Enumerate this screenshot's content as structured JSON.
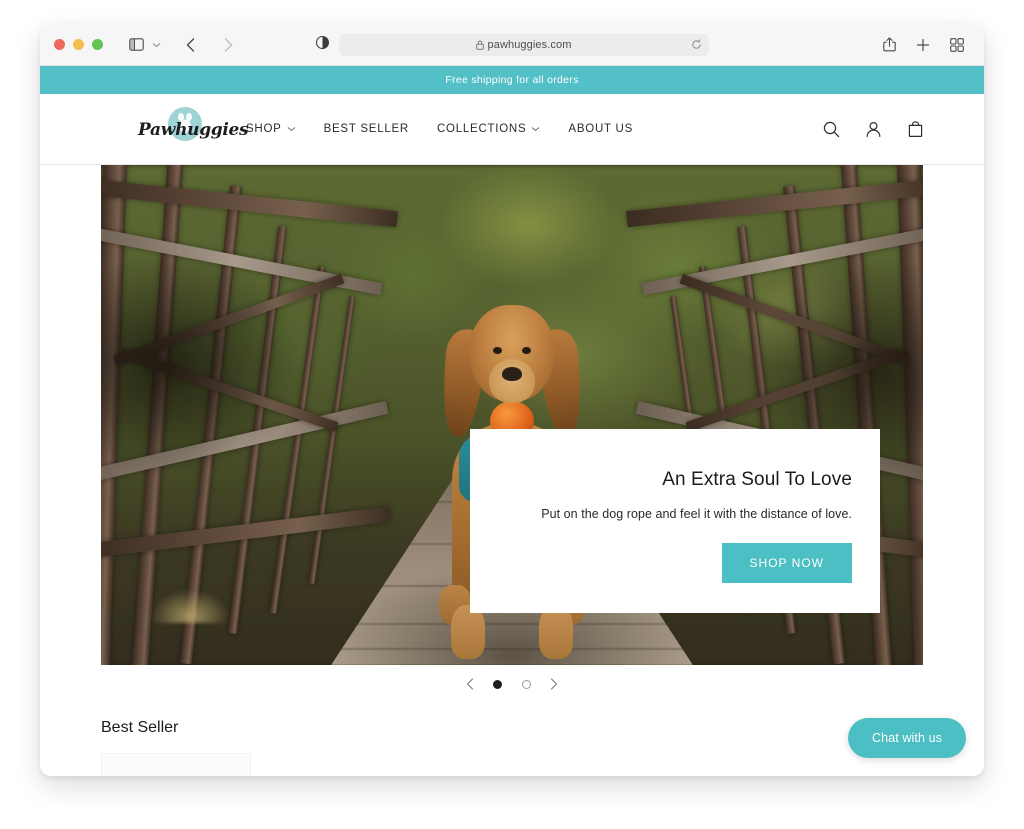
{
  "browser": {
    "url": "pawhuggies.com",
    "lock_icon": "lock-icon",
    "reload_icon": "reload-icon",
    "reader_icon": "reader-mode-icon",
    "sidebar_icon": "sidebar-toggle-icon",
    "sidebar_chevron": "chevron-down-icon",
    "back_icon": "back-arrow-icon",
    "forward_icon": "forward-arrow-icon",
    "share_icon": "share-icon",
    "new_tab_icon": "plus-icon",
    "tab_overview_icon": "tab-overview-icon",
    "traffic_lights": [
      "close",
      "minimize",
      "maximize"
    ]
  },
  "announcement": {
    "text": "Free shipping for all orders",
    "background": "#52c0c6"
  },
  "header": {
    "logo_text": "Pawhuggies",
    "nav": [
      {
        "label": "SHOP",
        "has_dropdown": true
      },
      {
        "label": "BEST SELLER",
        "has_dropdown": false
      },
      {
        "label": "COLLECTIONS",
        "has_dropdown": true
      },
      {
        "label": "ABOUT US",
        "has_dropdown": false
      }
    ],
    "actions": [
      {
        "name": "search-icon"
      },
      {
        "name": "account-icon"
      },
      {
        "name": "cart-icon"
      }
    ]
  },
  "hero": {
    "image_alt": "Golden retriever wearing a teal harness holding an orange ball on a wooden bridge",
    "title": "An Extra Soul To Love",
    "subtitle": "Put on the dog rope and feel it with the distance of love.",
    "cta_label": "SHOP NOW",
    "cta_color": "#4bbfc4",
    "carousel": {
      "prev_icon": "chevron-left-icon",
      "next_icon": "chevron-right-icon",
      "slides": 2,
      "active_slide": 1
    }
  },
  "sections": {
    "best_seller_title": "Best Seller"
  },
  "chat": {
    "label": "Chat with us",
    "color": "#4bbfc4"
  }
}
